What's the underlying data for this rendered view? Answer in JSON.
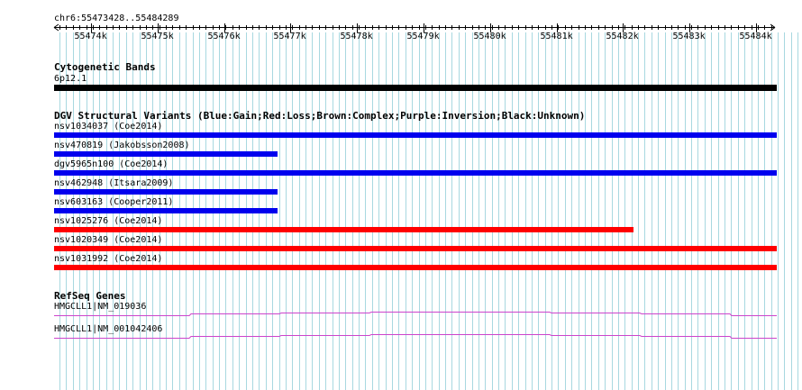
{
  "location": "chr6:55473428..55484289",
  "ruler": {
    "ticks": [
      "55474k",
      "55475k",
      "55476k",
      "55477k",
      "55478k",
      "55479k",
      "55480k",
      "55481k",
      "55482k",
      "55483k",
      "55484k"
    ]
  },
  "colors": {
    "grid": "#a8d8e0",
    "gain": "#0000ee",
    "loss": "#ff0000",
    "band": "#000000",
    "gene": "#cc44cc"
  },
  "cytoband": {
    "title": "Cytogenetic Bands",
    "label": "6p12.1"
  },
  "dgv": {
    "title": "DGV Structural Variants (Blue:Gain;Red:Loss;Brown:Complex;Purple:Inversion;Black:Unknown)",
    "variants": [
      {
        "label": "nsv1034037 (Coe2014)",
        "type": "gain"
      },
      {
        "label": "nsv470819 (Jakobsson2008)",
        "type": "gain"
      },
      {
        "label": "dgv5965n100 (Coe2014)",
        "type": "gain"
      },
      {
        "label": "nsv462948 (Itsara2009)",
        "type": "gain"
      },
      {
        "label": "nsv603163 (Cooper2011)",
        "type": "gain"
      },
      {
        "label": "nsv1025276 (Coe2014)",
        "type": "loss"
      },
      {
        "label": "nsv1020349 (Coe2014)",
        "type": "loss"
      },
      {
        "label": "nsv1031992 (Coe2014)",
        "type": "loss"
      }
    ]
  },
  "refseq": {
    "title": "RefSeq Genes",
    "genes": [
      {
        "label": "HMGCLL1|NM_019036"
      },
      {
        "label": "HMGCLL1|NM_001042406"
      }
    ]
  }
}
